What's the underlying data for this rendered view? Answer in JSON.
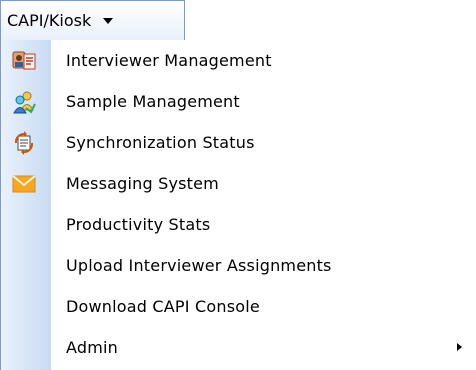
{
  "menu": {
    "title": "CAPI/Kiosk",
    "items": [
      {
        "label": "Interviewer Management",
        "icon": "interviewer-card-icon"
      },
      {
        "label": "Sample Management",
        "icon": "sample-people-icon"
      },
      {
        "label": "Synchronization Status",
        "icon": "sync-refresh-icon"
      },
      {
        "label": "Messaging System",
        "icon": "envelope-icon"
      },
      {
        "label": "Productivity Stats",
        "icon": ""
      },
      {
        "label": "Upload Interviewer Assignments",
        "icon": ""
      },
      {
        "label": "Download CAPI Console",
        "icon": ""
      },
      {
        "label": "Admin",
        "icon": "",
        "submenu": true
      }
    ]
  },
  "colors": {
    "border": "#7a9cc7",
    "gutter_start": "#eaf1fb",
    "gutter_end": "#c8dcf3",
    "envelope": "#f6a623"
  }
}
